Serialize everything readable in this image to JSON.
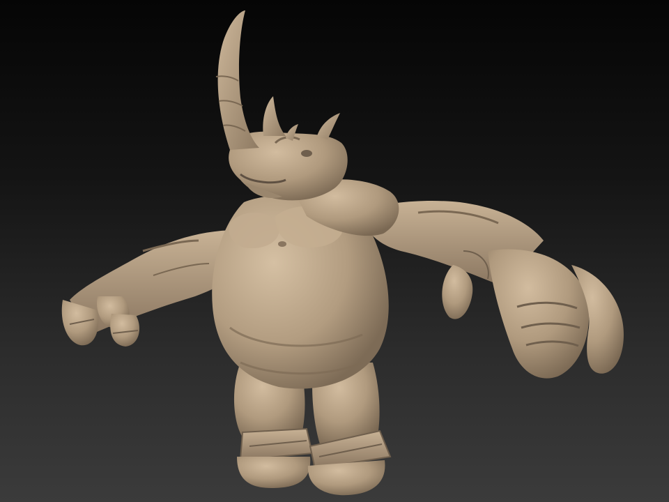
{
  "scene": {
    "subject": "rhino-creature-sculpt",
    "colors": {
      "background_top": "#050505",
      "background_bottom": "#3b3b3b",
      "clay_base": "#b09a7e",
      "clay_light": "#cdb79a",
      "clay_shadow": "#6f5f4d"
    }
  }
}
